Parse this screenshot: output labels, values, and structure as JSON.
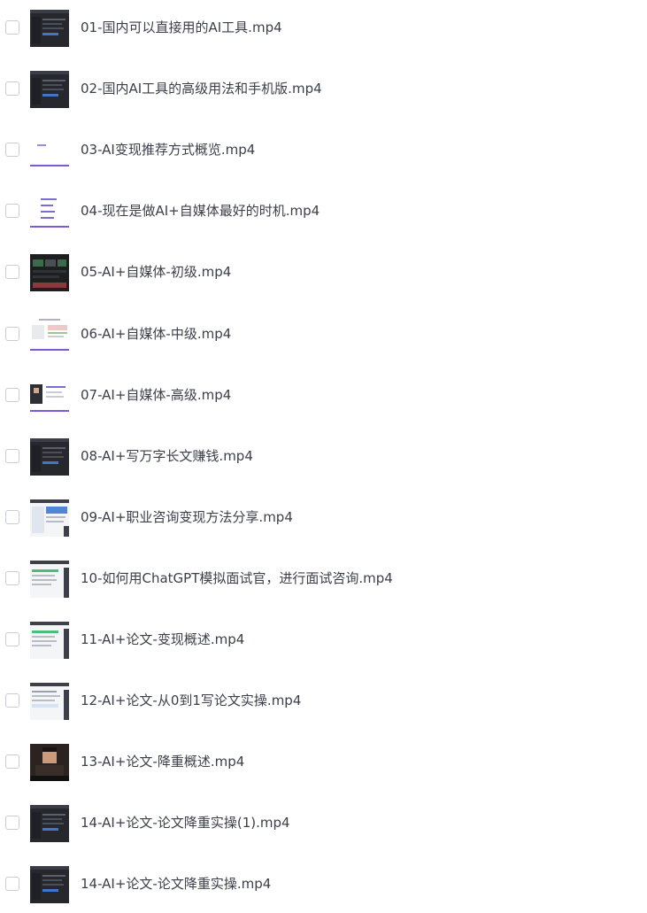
{
  "files": [
    {
      "name": "01-国内可以直接用的AI工具.mp4",
      "thumb_style": "dark-ui"
    },
    {
      "name": "02-国内AI工具的高级用法和手机版.mp4",
      "thumb_style": "dark-ui"
    },
    {
      "name": "03-AI变现推荐方式概览.mp4",
      "thumb_style": "light-slide"
    },
    {
      "name": "04-现在是做AI+自媒体最好的时机.mp4",
      "thumb_style": "light-slide-list"
    },
    {
      "name": "05-AI+自媒体-初级.mp4",
      "thumb_style": "dark-green"
    },
    {
      "name": "06-AI+自媒体-中级.mp4",
      "thumb_style": "light-doc"
    },
    {
      "name": "07-AI+自媒体-高级.mp4",
      "thumb_style": "light-doc-person"
    },
    {
      "name": "08-AI+写万字长文赚钱.mp4",
      "thumb_style": "dark-ui"
    },
    {
      "name": "09-AI+职业咨询变现方法分享.mp4",
      "thumb_style": "light-web-blue"
    },
    {
      "name": "10-如何用ChatGPT模拟面试官，进行面试咨询.mp4",
      "thumb_style": "light-web-green"
    },
    {
      "name": "11-AI+论文-变现概述.mp4",
      "thumb_style": "light-web-green"
    },
    {
      "name": "12-AI+论文-从0到1写论文实操.mp4",
      "thumb_style": "light-web"
    },
    {
      "name": "13-AI+论文-降重概述.mp4",
      "thumb_style": "person"
    },
    {
      "name": "14-AI+论文-论文降重实操(1).mp4",
      "thumb_style": "dark-ui"
    },
    {
      "name": "14-AI+论文-论文降重实操.mp4",
      "thumb_style": "dark-ui"
    }
  ],
  "colors": {
    "text": "#3b3f4a",
    "checkbox_border": "#c9ccd4",
    "accent_purple": "#7b5cd6"
  }
}
